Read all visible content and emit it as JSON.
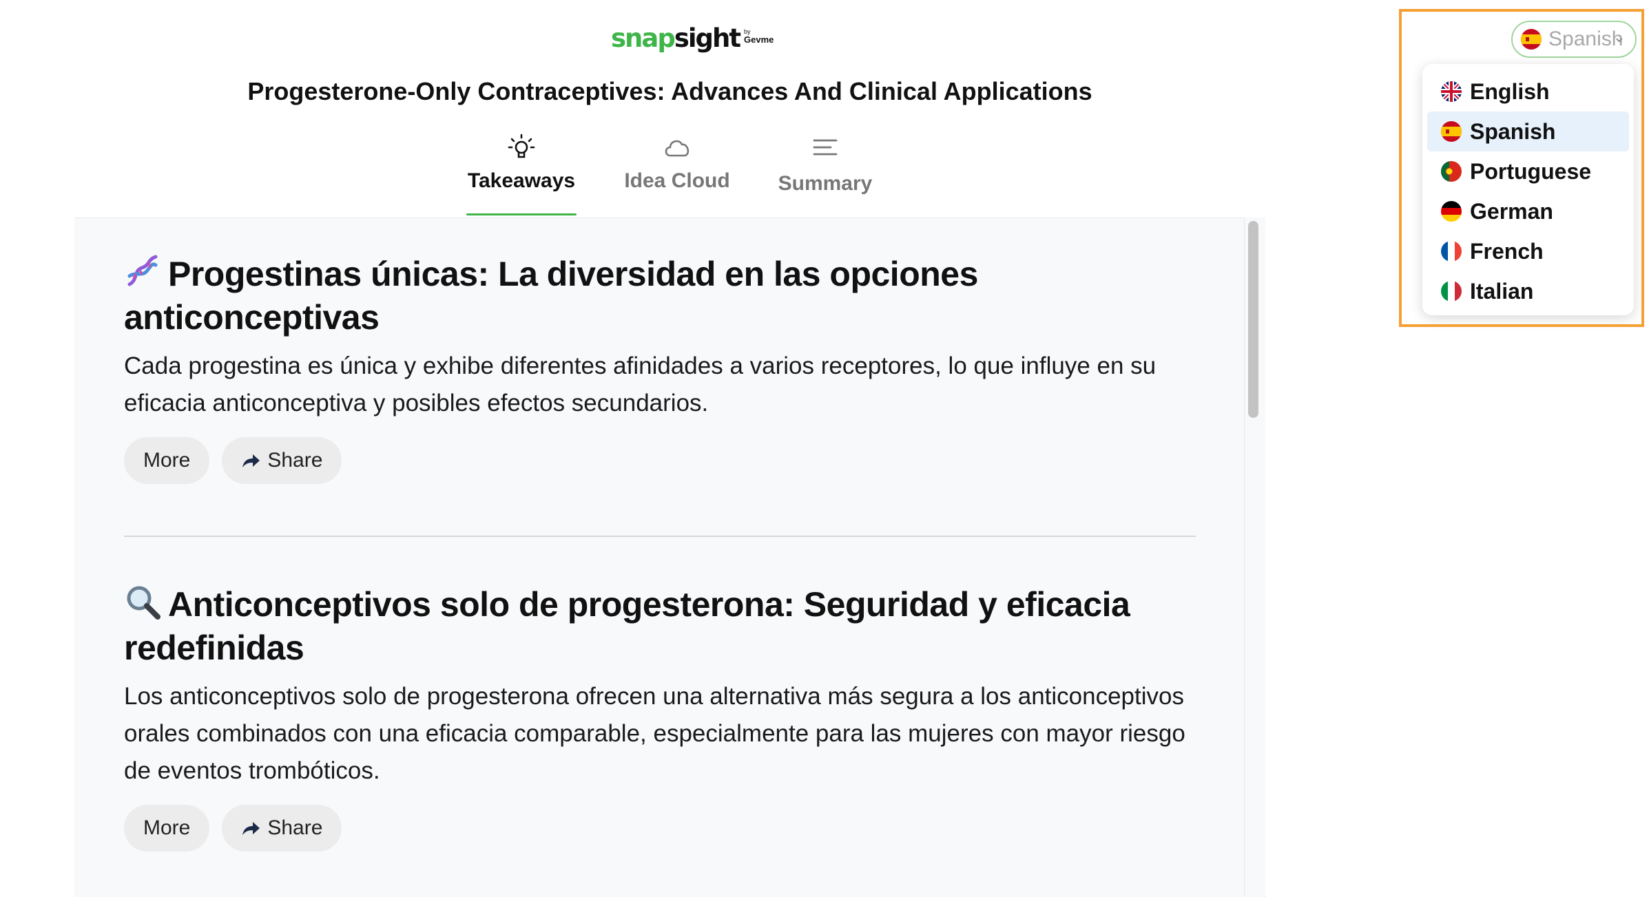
{
  "logo": {
    "snap": "snap",
    "sight": "sight",
    "by": "by",
    "brand": "Gevme"
  },
  "session": {
    "title": "Progesterone-Only Contraceptives: Advances And Clinical Applications"
  },
  "tabs": [
    {
      "label": "Takeaways",
      "icon": "lightbulb-icon",
      "active": true
    },
    {
      "label": "Idea Cloud",
      "icon": "cloud-icon",
      "active": false
    },
    {
      "label": "Summary",
      "icon": "lines-icon",
      "active": false
    }
  ],
  "takeaways": [
    {
      "emoji": "dna-icon",
      "title": "Progestinas únicas: La diversidad en las opciones anticonceptivas",
      "body": "Cada progestina es única y exhibe diferentes afinidades a varios receptores, lo que influye en su eficacia anticonceptiva y posibles efectos secundarios.",
      "more_label": "More",
      "share_label": "Share"
    },
    {
      "emoji": "magnifier-icon",
      "title": "Anticonceptivos solo de progesterona: Seguridad y eficacia redefinidas",
      "body": "Los anticonceptivos solo de progesterona ofrecen una alternativa más segura a los anticonceptivos orales combinados con una eficacia comparable, especialmente para las mujeres con mayor riesgo de eventos trombóticos.",
      "more_label": "More",
      "share_label": "Share"
    }
  ],
  "language": {
    "selected_label": "Spanish",
    "options": [
      {
        "label": "English",
        "flag": "uk-flag-icon"
      },
      {
        "label": "Spanish",
        "flag": "spain-flag-icon",
        "selected": true
      },
      {
        "label": "Portuguese",
        "flag": "portugal-flag-icon"
      },
      {
        "label": "German",
        "flag": "germany-flag-icon"
      },
      {
        "label": "French",
        "flag": "france-flag-icon"
      },
      {
        "label": "Italian",
        "flag": "italy-flag-icon"
      }
    ]
  },
  "colors": {
    "brand_green": "#3fb549",
    "highlight_orange": "#f5a035",
    "selected_row": "#e7f1fc",
    "panel_bg": "#f8f9fb"
  }
}
